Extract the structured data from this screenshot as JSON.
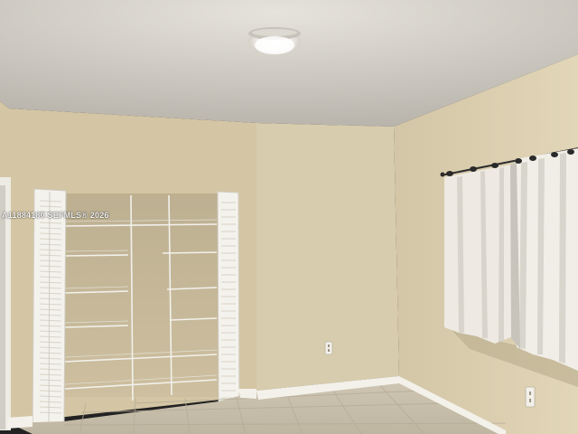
{
  "photo": {
    "watermark": "A11884180 SEFMLS® 2026"
  },
  "colors": {
    "ceiling": "#d9d5cc",
    "wall_left": "#d6c8a6",
    "wall_center": "#d9cdb0",
    "wall_right": "#ddd0b0",
    "baseboard": "#f3f1ea",
    "floor_tile": "#c9c0ad",
    "curtain": "#eeeae3",
    "closet_door": "#f4f2ec"
  }
}
